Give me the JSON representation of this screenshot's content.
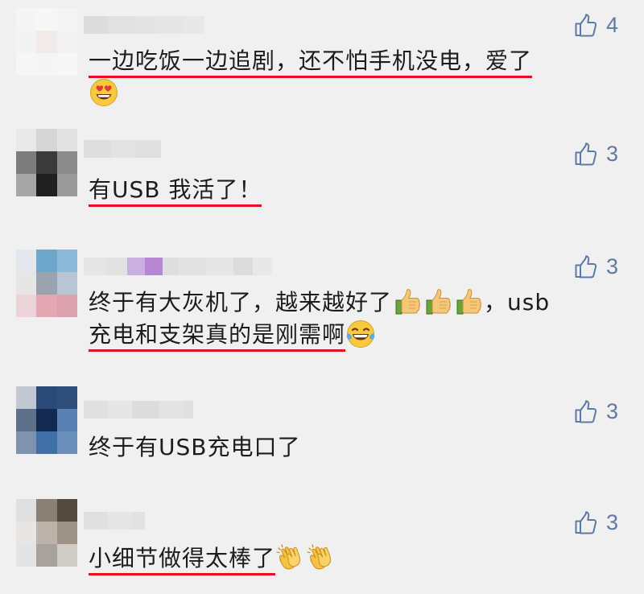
{
  "comments": [
    {
      "text_line1": "一边吃饭一边追剧，还不怕手机没电，爱了",
      "emoji": "heart-eyes-emoji",
      "likes": "4"
    },
    {
      "text": "有USB 我活了！",
      "likes": "3"
    },
    {
      "text_line1_plain": "终于有大灰机了，越来越好了",
      "text_line1_tail": "，usb",
      "text_line2": "充电和支架真的是刚需啊",
      "emoji_thumbs": "thumbs-up-emoji",
      "emoji_laugh": "tears-of-joy-emoji",
      "likes": "3"
    },
    {
      "text": "终于有USB充电口了",
      "likes": "3"
    },
    {
      "text": "小细节做得太棒了",
      "emoji": "clapping-hands-emoji",
      "likes": "3"
    }
  ],
  "colors": {
    "background": "#f0f0f0",
    "like_blue": "#5e79a6",
    "underline_red": "#e0141d",
    "text": "#1c1c1c"
  },
  "icons": {
    "like": "thumbs-up-outline-icon"
  }
}
